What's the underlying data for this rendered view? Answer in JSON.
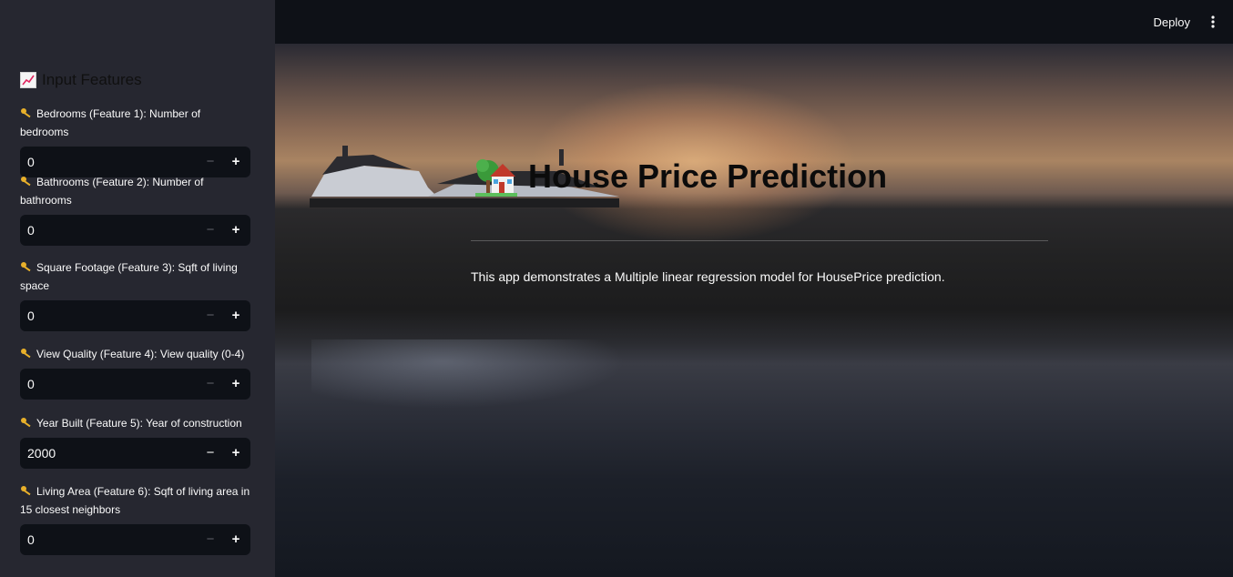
{
  "header": {
    "deploy_label": "Deploy",
    "menu_icon": "vertical-ellipsis-icon"
  },
  "sidebar": {
    "title_icon": "chart-increasing-icon",
    "title": "Input Features",
    "field_icon": "key-icon",
    "fields": [
      {
        "label": "Bedrooms (Feature 1): Number of bedrooms",
        "value": "0"
      },
      {
        "label": "Bathrooms (Feature 2): Number of bathrooms",
        "value": "0"
      },
      {
        "label": "Square Footage (Feature 3): Sqft of living space",
        "value": "0"
      },
      {
        "label": "View Quality (Feature 4): View quality (0-4)",
        "value": "0"
      },
      {
        "label": "Year Built (Feature 5): Year of construction",
        "value": "2000"
      },
      {
        "label": "Living Area (Feature 6): Sqft of living area in 15 closest neighbors",
        "value": "0"
      }
    ],
    "minus_label": "−",
    "plus_label": "+"
  },
  "main": {
    "title_icon": "house-with-garden-icon",
    "title": "House Price Prediction",
    "description": "This app demonstrates a Multiple linear regression model for HousePrice prediction."
  }
}
